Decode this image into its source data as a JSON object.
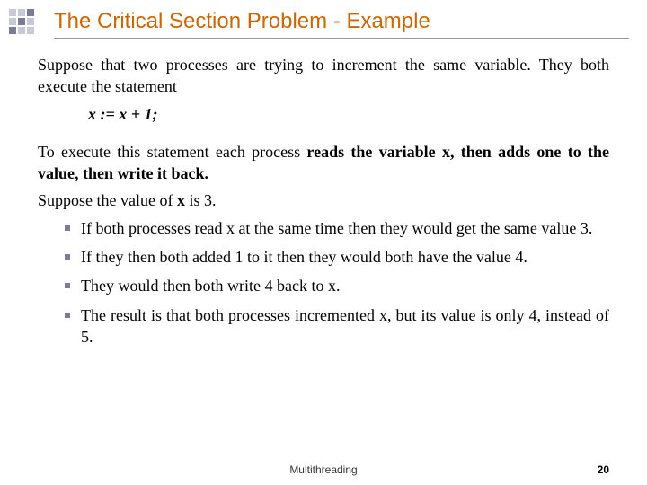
{
  "title": "The Critical Section Problem - Example",
  "p1": "Suppose that two processes are trying to increment the same variable. They both execute the statement",
  "code": "x := x + 1;",
  "p2_a": "To execute this statement each process ",
  "p2_b": "reads the variable x, then adds one to the value, then write it back.",
  "p3_a": "Suppose the value of ",
  "p3_b": "x",
  "p3_c": " is 3.",
  "bullets": [
    "If both processes read x at the same time then they would get the same value 3.",
    "If they then both added 1 to it then they would both have the value 4.",
    "They would then both write 4 back to x.",
    "The result is that both processes incremented x, but its value is only 4, instead of 5."
  ],
  "footer": "Multithreading",
  "page": "20"
}
